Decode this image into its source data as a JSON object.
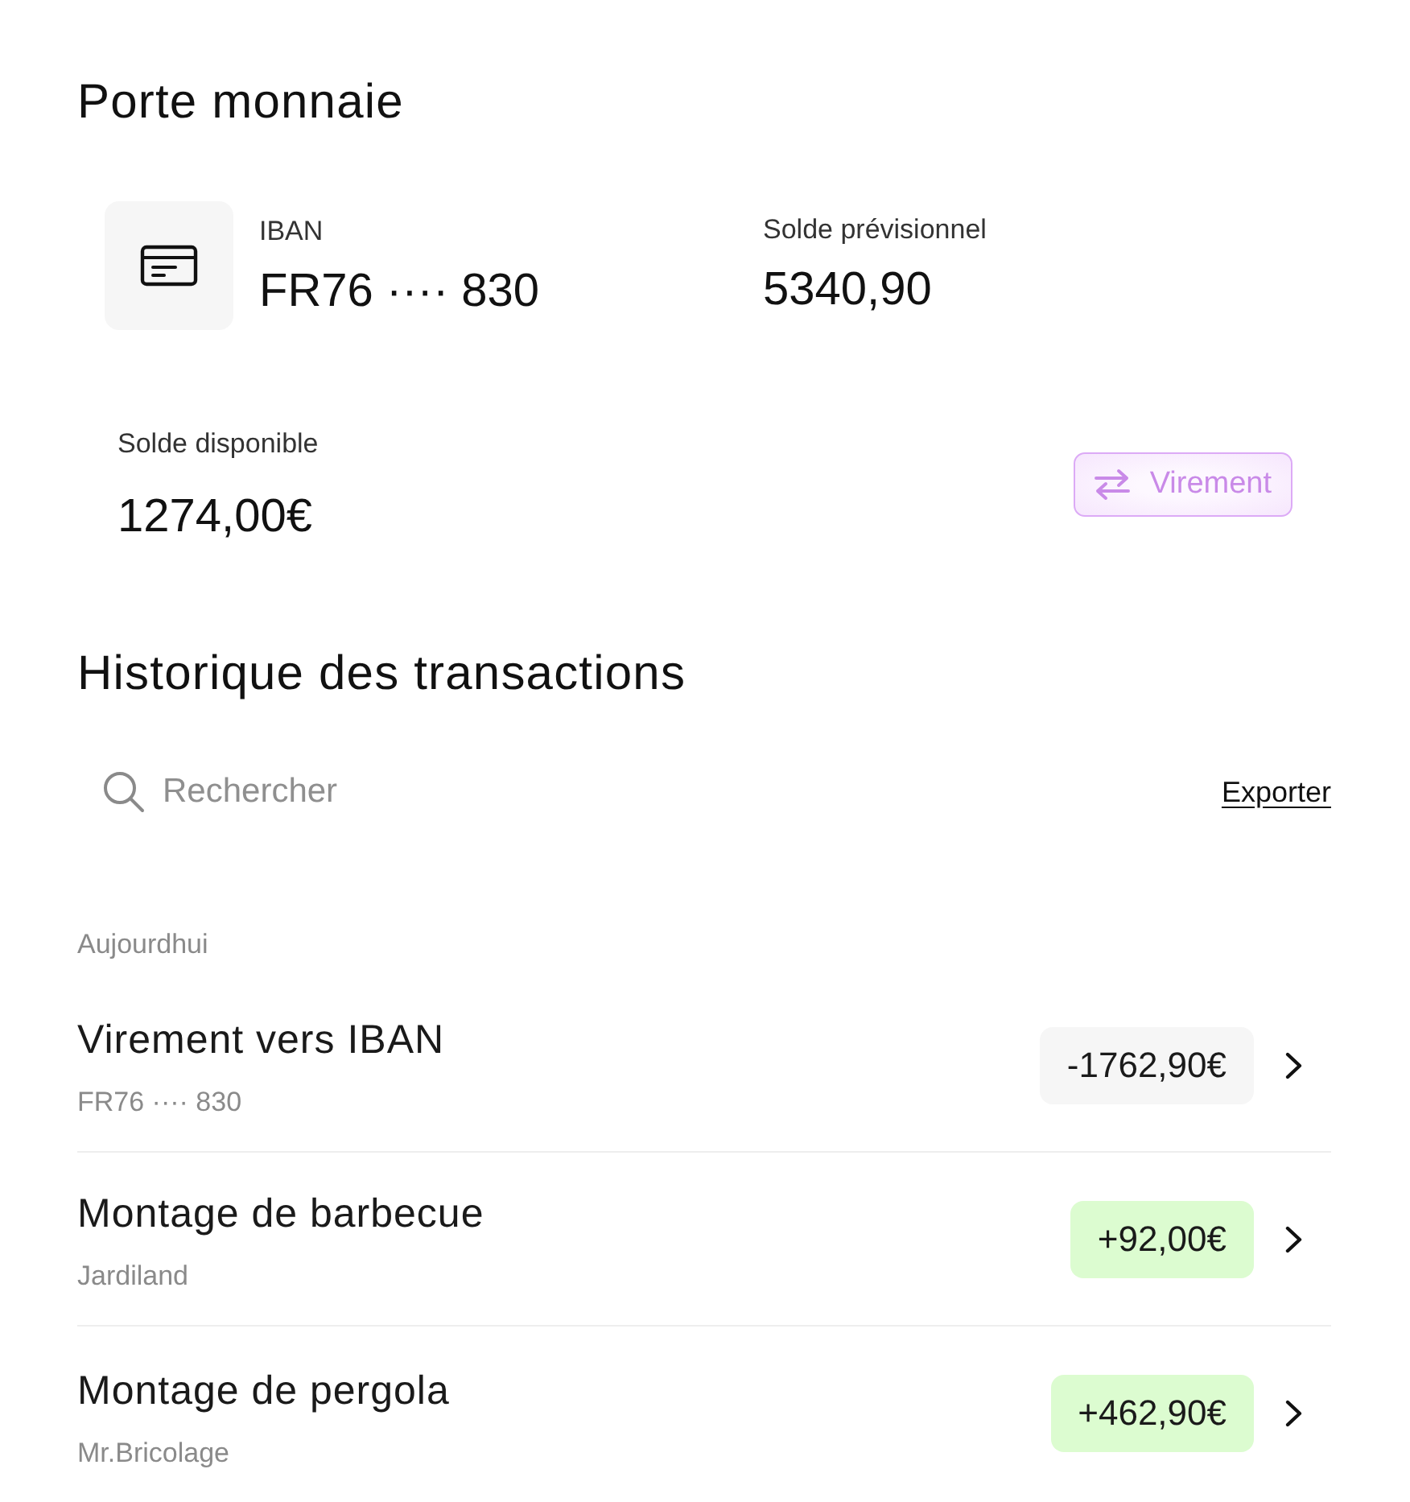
{
  "wallet": {
    "title": "Porte monnaie",
    "iban": {
      "label": "IBAN",
      "value": "FR76 ···· 830"
    },
    "forecast_balance": {
      "label": "Solde prévisionnel",
      "value": "5340,90"
    },
    "available_balance": {
      "label": "Solde disponible",
      "value": "1274,00€"
    },
    "transfer_button": "Virement"
  },
  "history": {
    "title": "Historique des transactions",
    "search": {
      "placeholder": "Rechercher"
    },
    "export_link": "Exporter",
    "groups": [
      {
        "label": "Aujourdhui",
        "transactions": [
          {
            "title": "Virement vers IBAN",
            "subtitle": "FR76 ···· 830",
            "amount": "-1762,90€",
            "kind": "debit"
          },
          {
            "title": "Montage de barbecue",
            "subtitle": "Jardiland",
            "amount": "+92,00€",
            "kind": "credit"
          },
          {
            "title": "Montage de pergola",
            "subtitle": "Mr.Bricolage",
            "amount": "+462,90€",
            "kind": "credit"
          }
        ]
      }
    ]
  }
}
